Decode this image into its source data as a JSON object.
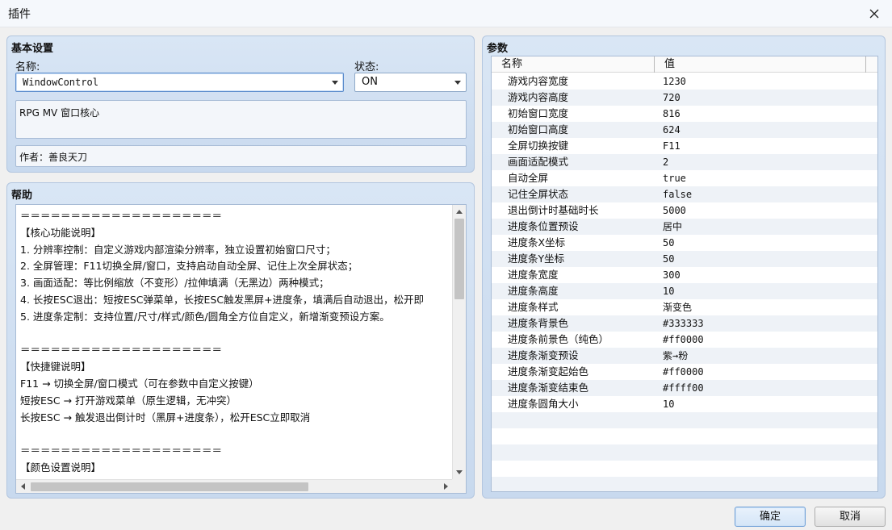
{
  "window": {
    "title": "插件"
  },
  "basic": {
    "title": "基本设置",
    "name_label": "名称:",
    "name_value": "WindowControl",
    "status_label": "状态:",
    "status_value": "ON",
    "description": "RPG MV 窗口核心",
    "author": "作者：善良天刀"
  },
  "help": {
    "title": "帮助",
    "lines": [
      "＝＝＝＝＝＝＝＝＝＝＝＝＝＝＝＝＝＝＝＝",
      "【核心功能说明】",
      "1. 分辨率控制：自定义游戏内部渲染分辨率，独立设置初始窗口尺寸；",
      "2. 全屏管理：F11切换全屏/窗口，支持启动自动全屏、记住上次全屏状态；",
      "3. 画面适配：等比例缩放（不变形）/拉伸填满（无黑边）两种模式；",
      "4. 长按ESC退出：短按ESC弹菜单，长按ESC触发黑屏+进度条，填满后自动退出，松开即",
      "5. 进度条定制：支持位置/尺寸/样式/颜色/圆角全方位自定义，新增渐变预设方案。",
      "",
      "＝＝＝＝＝＝＝＝＝＝＝＝＝＝＝＝＝＝＝＝",
      "【快捷键说明】",
      "F11 → 切换全屏/窗口模式（可在参数中自定义按键）",
      "短按ESC → 打开游戏菜单（原生逻辑，无冲突）",
      "长按ESC → 触发退出倒计时（黑屏+进度条），松开ESC立即取消",
      "",
      "＝＝＝＝＝＝＝＝＝＝＝＝＝＝＝＝＝＝＝＝",
      "【颜色设置说明】"
    ]
  },
  "params": {
    "title": "参数",
    "col_name": "名称",
    "col_value": "值",
    "rows": [
      {
        "name": "游戏内容宽度",
        "value": "1230"
      },
      {
        "name": "游戏内容高度",
        "value": "720"
      },
      {
        "name": "初始窗口宽度",
        "value": "816"
      },
      {
        "name": "初始窗口高度",
        "value": "624"
      },
      {
        "name": "全屏切换按键",
        "value": "F11"
      },
      {
        "name": "画面适配模式",
        "value": "2"
      },
      {
        "name": "自动全屏",
        "value": "true"
      },
      {
        "name": "记住全屏状态",
        "value": "false"
      },
      {
        "name": "退出倒计时基础时长",
        "value": "5000"
      },
      {
        "name": "进度条位置预设",
        "value": "居中"
      },
      {
        "name": "进度条X坐标",
        "value": "50"
      },
      {
        "name": "进度条Y坐标",
        "value": "50"
      },
      {
        "name": "进度条宽度",
        "value": "300"
      },
      {
        "name": "进度条高度",
        "value": "10"
      },
      {
        "name": "进度条样式",
        "value": "渐变色"
      },
      {
        "name": "进度条背景色",
        "value": "#333333"
      },
      {
        "name": "进度条前景色（纯色）",
        "value": "#ff0000"
      },
      {
        "name": "进度条渐变预设",
        "value": "紫→粉"
      },
      {
        "name": "进度条渐变起始色",
        "value": "#ff0000"
      },
      {
        "name": "进度条渐变结束色",
        "value": "#ffff00"
      },
      {
        "name": "进度条圆角大小",
        "value": "10"
      },
      {
        "name": "",
        "value": ""
      },
      {
        "name": "",
        "value": ""
      },
      {
        "name": "",
        "value": ""
      },
      {
        "name": "",
        "value": ""
      },
      {
        "name": "",
        "value": ""
      }
    ]
  },
  "buttons": {
    "ok": "确定",
    "cancel": "取消"
  }
}
